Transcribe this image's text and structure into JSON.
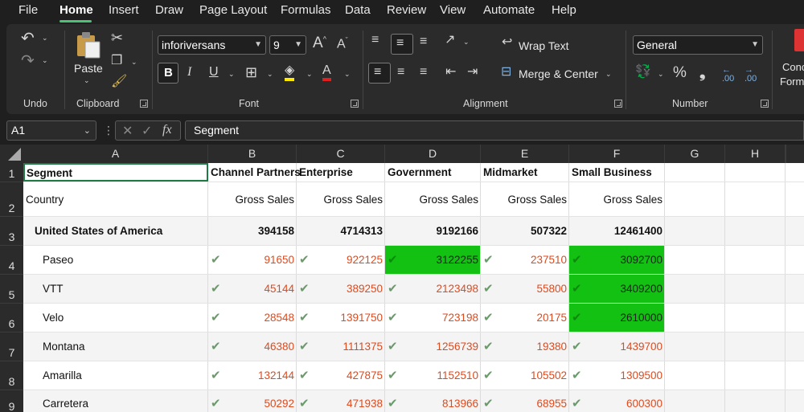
{
  "menu": {
    "items": [
      "File",
      "Home",
      "Insert",
      "Draw",
      "Page Layout",
      "Formulas",
      "Data",
      "Review",
      "View",
      "Automate",
      "Help"
    ],
    "active": "Home"
  },
  "ribbon": {
    "groups": {
      "undo": "Undo",
      "clipboard": "Clipboard",
      "font": "Font",
      "alignment": "Alignment",
      "number": "Number"
    },
    "paste_label": "Paste",
    "font_name": "inforiversans",
    "font_size": "9",
    "wrap_text": "Wrap Text",
    "merge_center": "Merge & Center",
    "number_format": "General",
    "cond_format_partial_1": "Conc",
    "cond_format_partial_2": "Form",
    "bold_label": "B",
    "italic_label": "I",
    "underline_label": "U",
    "grow_font": "A",
    "shrink_font": "A",
    "percent": "%",
    "comma": "❟",
    "inc_decimal": ".00",
    "dec_decimal": ".00"
  },
  "formula_bar": {
    "name_box": "A1",
    "content": "Segment",
    "fx": "fx"
  },
  "columns": [
    "A",
    "B",
    "C",
    "D",
    "E",
    "F",
    "G",
    "H"
  ],
  "rows": {
    "r1": {
      "num": "1",
      "a": "Segment",
      "b": "Channel Partners",
      "c": "Enterprise",
      "d": "Government",
      "e": "Midmarket",
      "f": "Small Business"
    },
    "r2": {
      "num": "2",
      "a": "Country",
      "b": "Gross Sales",
      "c": "Gross Sales",
      "d": "Gross Sales",
      "e": "Gross Sales",
      "f": "Gross Sales"
    },
    "r3": {
      "num": "3",
      "a": "United States of America",
      "b": "394158",
      "c": "4714313",
      "d": "9192166",
      "e": "507322",
      "f": "12461400"
    },
    "r4": {
      "num": "4",
      "a": "Paseo",
      "b": "91650",
      "c": "922125",
      "d": "3122255",
      "e": "237510",
      "f": "3092700"
    },
    "r5": {
      "num": "5",
      "a": "VTT",
      "b": "45144",
      "c": "389250",
      "d": "2123498",
      "e": "55800",
      "f": "3409200"
    },
    "r6": {
      "num": "6",
      "a": "Velo",
      "b": "28548",
      "c": "1391750",
      "d": "723198",
      "e": "20175",
      "f": "2610000"
    },
    "r7": {
      "num": "7",
      "a": "Montana",
      "b": "46380",
      "c": "1111375",
      "d": "1256739",
      "e": "19380",
      "f": "1439700"
    },
    "r8": {
      "num": "8",
      "a": "Amarilla",
      "b": "132144",
      "c": "427875",
      "d": "1152510",
      "e": "105502",
      "f": "1309500"
    },
    "r9": {
      "num": "9",
      "a": "Carretera",
      "b": "50292",
      "c": "471938",
      "d": "813966",
      "e": "68955",
      "f": "600300"
    }
  },
  "colors": {
    "accent": "#4cc274",
    "highlight_green": "#12c112",
    "value_red": "#e04a1c",
    "check_icon": "#6b9a6b"
  },
  "check_icon_name": "check-icon"
}
